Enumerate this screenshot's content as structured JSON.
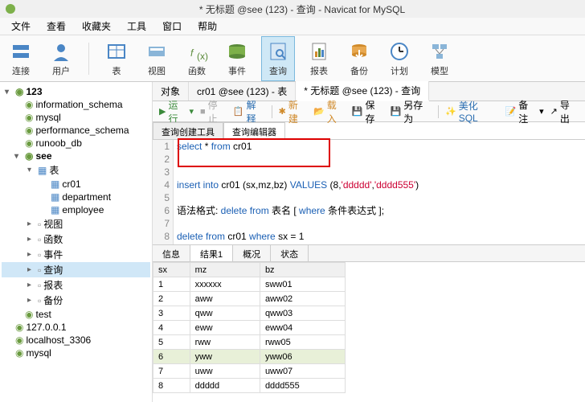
{
  "title": "* 无标题 @see (123) - 查询 - Navicat for MySQL",
  "menu": [
    "文件",
    "查看",
    "收藏夹",
    "工具",
    "窗口",
    "帮助"
  ],
  "toolbar": [
    {
      "lbl": "连接"
    },
    {
      "lbl": "用户"
    },
    {
      "sep": true
    },
    {
      "lbl": "表"
    },
    {
      "lbl": "视图"
    },
    {
      "lbl": "函数"
    },
    {
      "lbl": "事件"
    },
    {
      "lbl": "查询",
      "active": true
    },
    {
      "lbl": "报表"
    },
    {
      "lbl": "备份"
    },
    {
      "lbl": "计划"
    },
    {
      "lbl": "模型"
    }
  ],
  "tree": [
    {
      "lvl": 0,
      "caret": "▾",
      "ico": "db",
      "txt": "123",
      "bold": true
    },
    {
      "lvl": 1,
      "ico": "db",
      "txt": "information_schema"
    },
    {
      "lvl": 1,
      "ico": "db",
      "txt": "mysql"
    },
    {
      "lvl": 1,
      "ico": "db",
      "txt": "performance_schema"
    },
    {
      "lvl": 1,
      "ico": "db",
      "txt": "runoob_db"
    },
    {
      "lvl": 1,
      "caret": "▾",
      "ico": "db",
      "txt": "see",
      "bold": true
    },
    {
      "lvl": 2,
      "caret": "▾",
      "ico": "tbl",
      "txt": "表"
    },
    {
      "lvl": 3,
      "ico": "tbl",
      "txt": "cr01"
    },
    {
      "lvl": 3,
      "ico": "tbl",
      "txt": "department"
    },
    {
      "lvl": 3,
      "ico": "tbl",
      "txt": "employee"
    },
    {
      "lvl": 2,
      "caret": "▸",
      "ico": "gray",
      "txt": "视图"
    },
    {
      "lvl": 2,
      "caret": "▸",
      "ico": "gray",
      "txt": "函数"
    },
    {
      "lvl": 2,
      "caret": "▸",
      "ico": "gray",
      "txt": "事件"
    },
    {
      "lvl": 2,
      "caret": "▸",
      "ico": "gray",
      "txt": "查询",
      "sel": true
    },
    {
      "lvl": 2,
      "caret": "▸",
      "ico": "gray",
      "txt": "报表"
    },
    {
      "lvl": 2,
      "caret": "▸",
      "ico": "gray",
      "txt": "备份"
    },
    {
      "lvl": 1,
      "ico": "db",
      "txt": "test"
    },
    {
      "lvl": 0,
      "ico": "db",
      "txt": "127.0.0.1"
    },
    {
      "lvl": 0,
      "ico": "db",
      "txt": "localhost_3306"
    },
    {
      "lvl": 0,
      "ico": "db",
      "txt": "mysql"
    }
  ],
  "tabs1": [
    {
      "lbl": "对象"
    },
    {
      "lbl": "cr01 @see (123) - 表"
    },
    {
      "lbl": "* 无标题 @see (123) - 查询",
      "active": true
    }
  ],
  "qbar": {
    "run": "运行",
    "stop": "停止",
    "explain": "解释",
    "new": "新建",
    "load": "载入",
    "save": "保存",
    "saveas": "另存为",
    "beautify": "美化 SQL",
    "note": "备注",
    "export": "导出"
  },
  "subtabs": {
    "builder": "查询创建工具",
    "editor": "查询编辑器"
  },
  "code_lines": [
    {
      "n": 1,
      "html": "<span class='kw'>select</span> * <span class='kw'>from</span> cr01"
    },
    {
      "n": 2,
      "html": ""
    },
    {
      "n": 3,
      "html": ""
    },
    {
      "n": 4,
      "html": "<span class='kw'>insert into</span> cr01 (sx,mz,bz) <span class='kw'>VALUES</span> (8,<span class='str'>'ddddd'</span>,<span class='str'>'dddd555'</span>)"
    },
    {
      "n": 5,
      "html": ""
    },
    {
      "n": 6,
      "html": "语法格式: <span class='kw'>delete from</span> 表名 [ <span class='kw'>where</span> 条件表达式 ];"
    },
    {
      "n": 7,
      "html": ""
    },
    {
      "n": 8,
      "html": "<span class='kw'>delete from</span> cr01 <span class='kw'>where</span> sx = 1"
    }
  ],
  "restabs": [
    "信息",
    "结果1",
    "概况",
    "状态"
  ],
  "restab_active": 1,
  "result": {
    "cols": [
      "sx",
      "mz",
      "bz"
    ],
    "rows": [
      [
        1,
        "xxxxxx",
        "sww01"
      ],
      [
        2,
        "aww",
        "aww02"
      ],
      [
        3,
        "qww",
        "qww03"
      ],
      [
        4,
        "eww",
        "eww04"
      ],
      [
        5,
        "rww",
        "rww05"
      ],
      [
        6,
        "yww",
        "yww06"
      ],
      [
        7,
        "uww",
        "uww07"
      ],
      [
        8,
        "ddddd",
        "dddd555"
      ]
    ],
    "hl_row": 5
  }
}
